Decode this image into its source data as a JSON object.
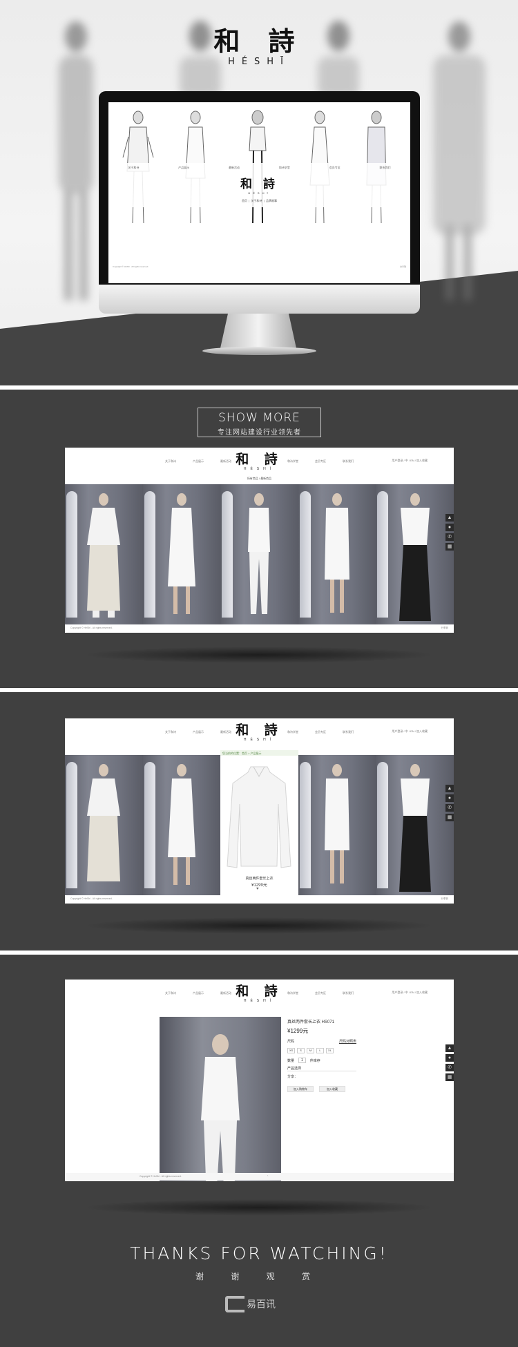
{
  "brand": {
    "zh": "和 詩",
    "en": "HÉSHĪ"
  },
  "hero_screen": {
    "nav": [
      "关于和诗",
      "产品展示",
      "最新活动",
      "和诗学堂",
      "会员专区",
      "联系我们"
    ],
    "sub": [
      "首页",
      "关于和诗",
      "品牌故事"
    ],
    "footer_left": "Copyright © HeShi . All rights reserved.",
    "footer_right": "分享到"
  },
  "show_more": {
    "title": "SHOW MORE",
    "subtitle": "专注网站建设行业领先者"
  },
  "site": {
    "nav_left": [
      "关于和诗",
      "产品展示",
      "最新活动"
    ],
    "nav_right": [
      "和诗学堂",
      "会员专区",
      "联系我们"
    ],
    "top_right": [
      "用户登录",
      "中 / EN",
      "加入收藏"
    ],
    "sub_tabs": [
      "所有商品",
      "/",
      "最新商品"
    ],
    "footer": "Copyright © HeShi . All rights reserved.",
    "footer_right": "分享到"
  },
  "card": {
    "bar": "您当前的位置：首页 > 产品展示",
    "name": "真丝两件套长上衣",
    "price": "¥1299元"
  },
  "detail": {
    "title": "真丝两件套长上衣  HS071",
    "price": "¥1299元",
    "size_label": "尺码",
    "size_link": "尺码对照表",
    "sizes": [
      "XS",
      "S",
      "M",
      "L",
      "XL"
    ],
    "qty_label": "数量",
    "qty": "1",
    "stock": "件库存",
    "color_label": "产品选择",
    "share_label": "分享：",
    "buy": "加入购物车",
    "fav": "加入收藏"
  },
  "thanks": {
    "title": "THANKS FOR WATCHING!",
    "subtitle": "谢 谢 观 赏"
  },
  "footer_logo": "易百讯"
}
